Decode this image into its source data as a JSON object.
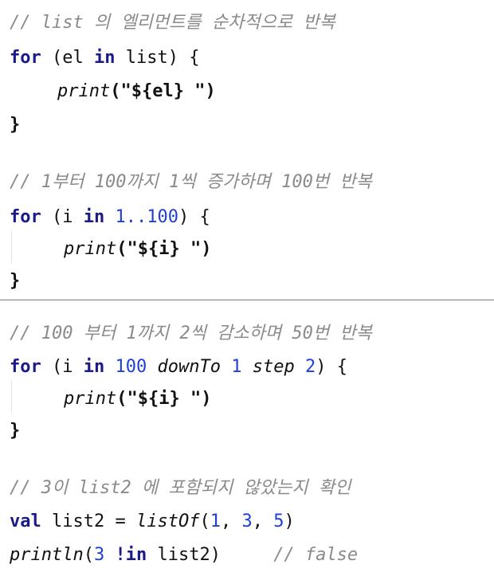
{
  "block1": {
    "comment": "// list 의 엘리먼트를 순차적으로 반복",
    "kw_for": "for",
    "paren_open": "(el",
    "kw_in": "in",
    "rest": "list) {",
    "print_fn": "print",
    "print_arg_open": "(\"",
    "template": "${el}",
    "print_arg_close": " \")",
    "close_brace": "}"
  },
  "block2": {
    "comment": "// 1부터 100까지 1씩 증가하며 100번 반복",
    "kw_for": "for",
    "paren_open": "(i",
    "kw_in": "in",
    "range": "1..100",
    "rest": ") {",
    "print_fn": "print",
    "print_arg_open": "(\"",
    "template": "${i}",
    "print_arg_close": " \")",
    "close_brace": "}"
  },
  "block3": {
    "comment": "// 100 부터 1까지 2씩 감소하며 50번 반복",
    "kw_for": "for",
    "paren_open": "(i",
    "kw_in": "in",
    "start": "100",
    "down_to": "downTo",
    "end": "1",
    "step": "step",
    "step_val": "2",
    "rest": ") {",
    "print_fn": "print",
    "print_arg_open": "(\"",
    "template": "${i}",
    "print_arg_close": " \")",
    "close_brace": "}"
  },
  "block4": {
    "comment": "// 3이 list2 에 포함되지 않았는지 확인",
    "kw_val": "val",
    "decl": "list2 =",
    "list_of": "listOf",
    "list_open": "(",
    "v1": "1",
    "sep1": ", ",
    "v2": "3",
    "sep2": ", ",
    "v3": "5",
    "list_close": ")",
    "println_fn": "println",
    "paren_open": "(",
    "three": "3",
    "not_in": "!in",
    "rest": "list2)",
    "trailing_comment": "// false"
  }
}
